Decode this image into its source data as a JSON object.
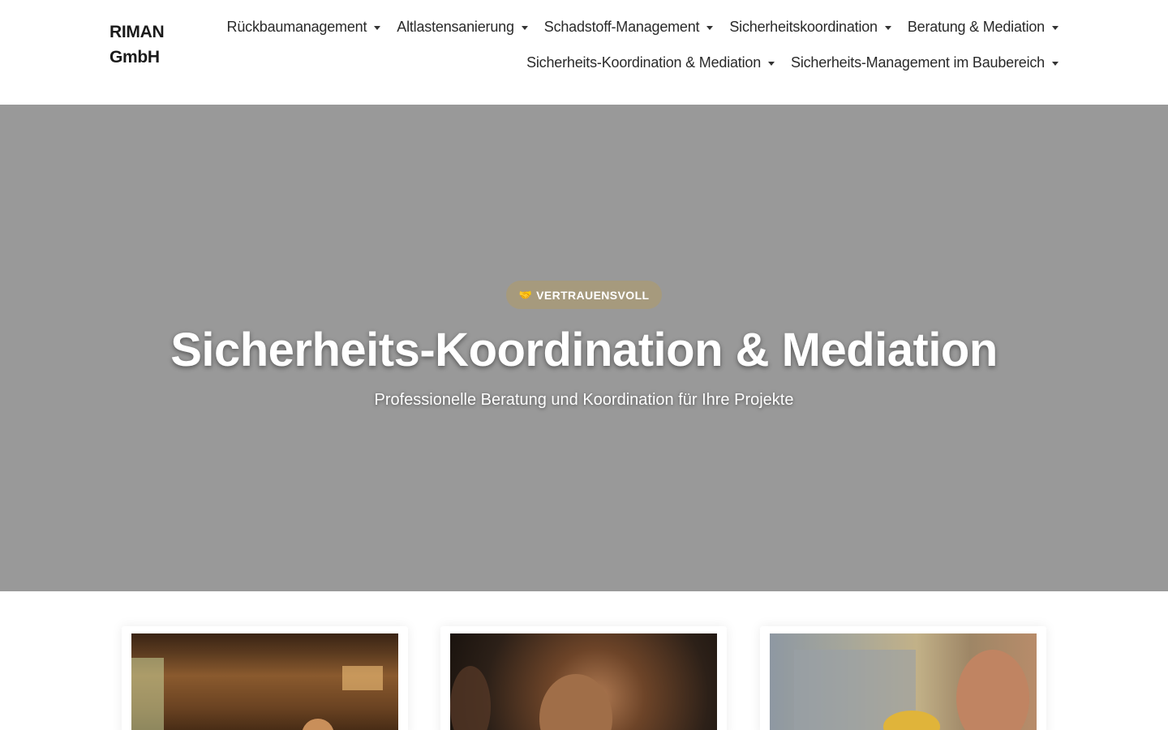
{
  "brand": {
    "logo_line1": "RIMAN",
    "logo_line2": "GmbH"
  },
  "nav": {
    "row1": [
      {
        "label": "Rückbaumanagement"
      },
      {
        "label": "Altlastensanierung"
      },
      {
        "label": "Schadstoff-Management"
      },
      {
        "label": "Sicherheitskoordination"
      },
      {
        "label": "Beratung & Mediation"
      }
    ],
    "row2": [
      {
        "label": "Sicherheits-Koordination & Mediation"
      },
      {
        "label": "Sicherheits-Management im Baubereich"
      }
    ]
  },
  "hero": {
    "badge_icon": "handshake-icon",
    "badge_label": "VERTRAUENSVOLL",
    "title": "Sicherheits-Koordination & Mediation",
    "subtitle": "Professionelle Beratung und Koordination für Ihre Projekte",
    "background_color": "#999999",
    "badge_color": "#a69a7d"
  },
  "cards": [
    {
      "image": "meeting-room-photo"
    },
    {
      "image": "man-portrait-photo"
    },
    {
      "image": "construction-site-photo"
    }
  ]
}
